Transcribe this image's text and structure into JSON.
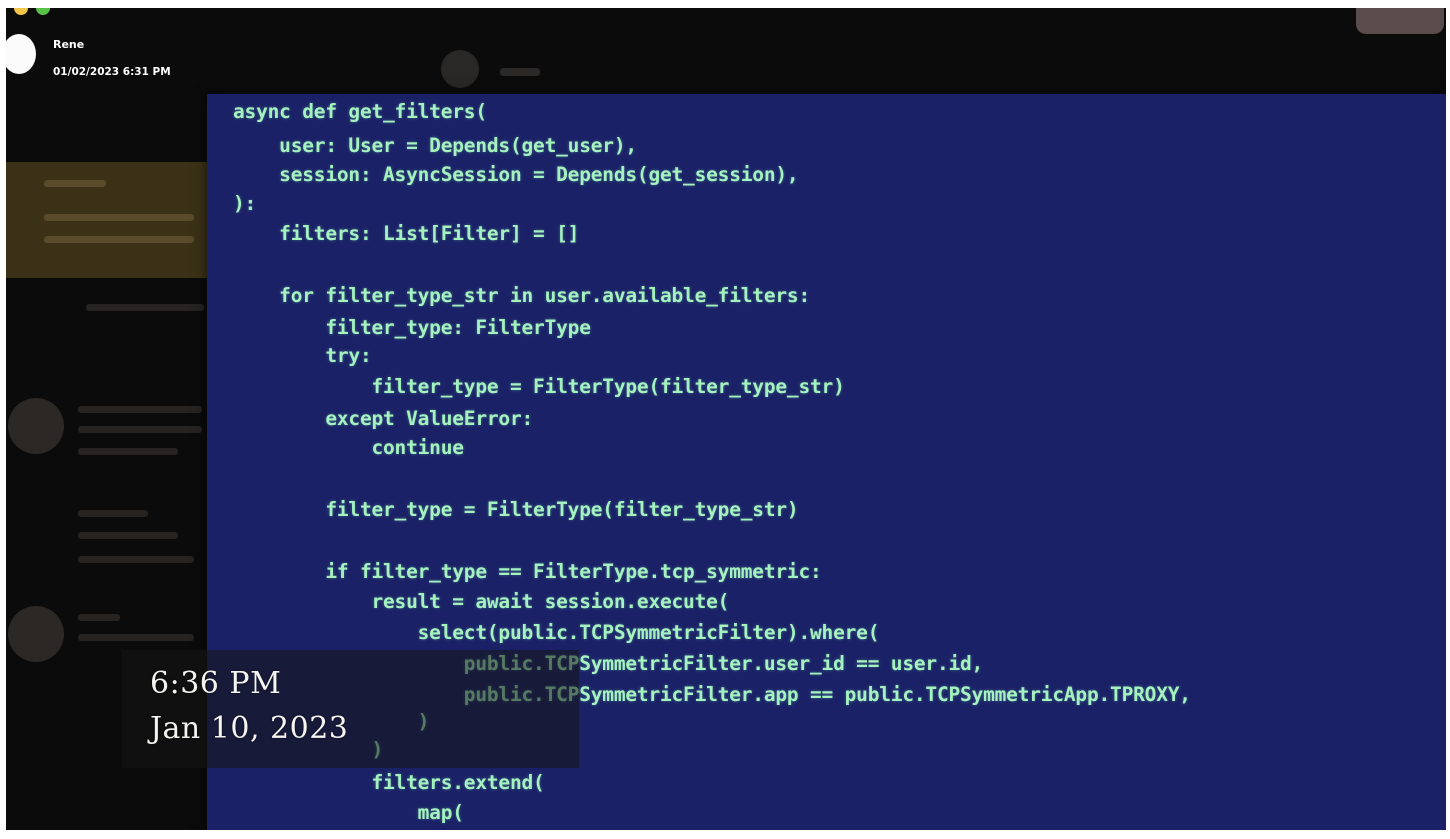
{
  "chat": {
    "sender": "Rene",
    "timestamp": "01/02/2023 6:31 PM"
  },
  "code": {
    "lines": [
      "async def get_filters(",
      "    user: User = Depends(get_user),",
      "    session: AsyncSession = Depends(get_session),",
      "):",
      "    filters: List[Filter] = []",
      "    for filter_type_str in user.available_filters:",
      "        filter_type: FilterType",
      "        try:",
      "            filter_type = FilterType(filter_type_str)",
      "        except ValueError:",
      "            continue",
      "        filter_type = FilterType(filter_type_str)",
      "        if filter_type == FilterType.tcp_symmetric:",
      "            result = await session.execute(",
      "                select(public.TCPSymmetricFilter).where(",
      "                    public.TCPSymmetricFilter.user_id == user.id,",
      "                    public.TCPSymmetricFilter.app == public.TCPSymmetricApp.TPROXY,",
      "                )",
      "            )",
      "            filters.extend(",
      "                map("
    ]
  },
  "overlay": {
    "time": "6:36 PM",
    "date": "Jan 10, 2023"
  }
}
